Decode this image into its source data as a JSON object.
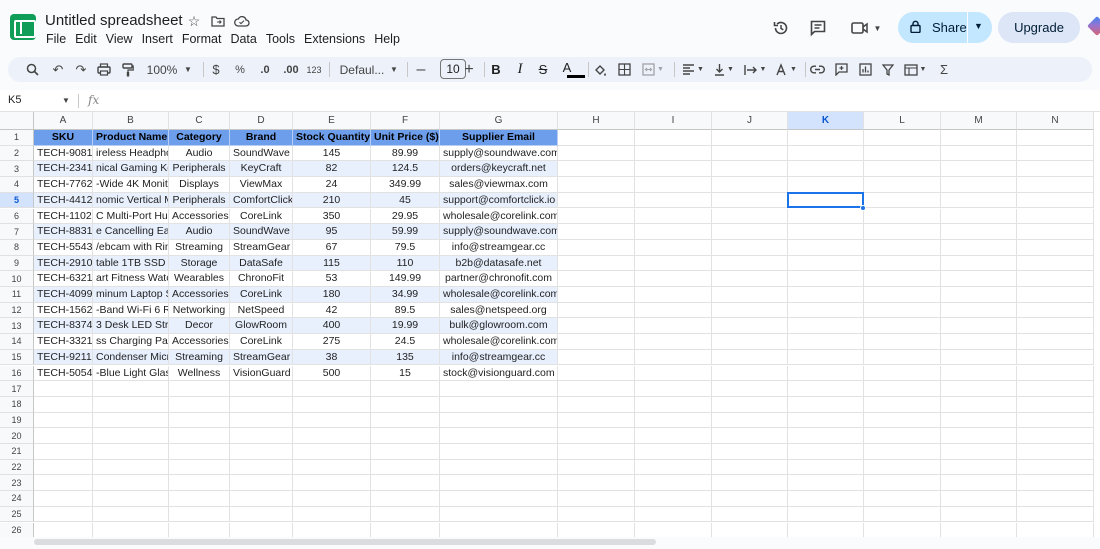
{
  "app": {
    "doc_title": "Untitled spreadsheet",
    "menu": [
      "File",
      "Edit",
      "View",
      "Insert",
      "Format",
      "Data",
      "Tools",
      "Extensions",
      "Help"
    ],
    "share_label": "Share",
    "upgrade_label": "Upgrade"
  },
  "toolbar": {
    "zoom": "100%",
    "currency": "$",
    "percent": "%",
    "dec_decrease": ".0",
    "dec_increase": ".00",
    "number_format": "123",
    "font": "Defaul...",
    "font_size": "10",
    "bold": "B",
    "italic": "I",
    "strike": "S",
    "text_color": "A"
  },
  "formula_bar": {
    "namebox": "K5",
    "fx": "fx",
    "content": ""
  },
  "grid": {
    "columns": [
      "A",
      "B",
      "C",
      "D",
      "E",
      "F",
      "G",
      "H",
      "I",
      "J",
      "K",
      "L",
      "M",
      "N"
    ],
    "selected_column": "K",
    "selected_row": 5,
    "row_count": 26,
    "header_row": [
      "SKU",
      "Product Name",
      "Category",
      "Brand",
      "Stock Quantity",
      "Unit Price ($)",
      "Supplier Email"
    ],
    "rows": [
      [
        "TECH-9081",
        "ireless Headphor",
        "Audio",
        "SoundWave",
        "145",
        "89.99",
        "supply@soundwave.com"
      ],
      [
        "TECH-2341",
        "nical Gaming Ke",
        "Peripherals",
        "KeyCraft",
        "82",
        "124.5",
        "orders@keycraft.net"
      ],
      [
        "TECH-7762",
        "-Wide 4K Monito",
        "Displays",
        "ViewMax",
        "24",
        "349.99",
        "sales@viewmax.com"
      ],
      [
        "TECH-4412",
        "nomic Vertical M",
        "Peripherals",
        "ComfortClick",
        "210",
        "45",
        "support@comfortclick.io"
      ],
      [
        "TECH-1102",
        "C Multi-Port Hub",
        "Accessories",
        "CoreLink",
        "350",
        "29.95",
        "wholesale@corelink.com"
      ],
      [
        "TECH-8831",
        "e Cancelling Earl",
        "Audio",
        "SoundWave",
        "95",
        "59.99",
        "supply@soundwave.com"
      ],
      [
        "TECH-5543",
        "/ebcam with Ring",
        "Streaming",
        "StreamGear",
        "67",
        "79.5",
        "info@streamgear.cc"
      ],
      [
        "TECH-2910",
        "table 1TB SSD D",
        "Storage",
        "DataSafe",
        "115",
        "110",
        "b2b@datasafe.net"
      ],
      [
        "TECH-6321",
        "art Fitness Watch",
        "Wearables",
        "ChronoFit",
        "53",
        "149.99",
        "partner@chronofit.com"
      ],
      [
        "TECH-4099",
        "minum Laptop St",
        "Accessories",
        "CoreLink",
        "180",
        "34.99",
        "wholesale@corelink.com"
      ],
      [
        "TECH-1562",
        "-Band Wi-Fi 6 Ro",
        "Networking",
        "NetSpeed",
        "42",
        "89.5",
        "sales@netspeed.org"
      ],
      [
        "TECH-8374",
        "3 Desk LED Strip",
        "Decor",
        "GlowRoom",
        "400",
        "19.99",
        "bulk@glowroom.com"
      ],
      [
        "TECH-3321",
        "ss Charging Pac",
        "Accessories",
        "CoreLink",
        "275",
        "24.5",
        "wholesale@corelink.com"
      ],
      [
        "TECH-9211",
        "Condenser Micro",
        "Streaming",
        "StreamGear",
        "38",
        "135",
        "info@streamgear.cc"
      ],
      [
        "TECH-5054",
        "-Blue Light Glas",
        "Wellness",
        "VisionGuard",
        "500",
        "15",
        "stock@visionguard.com"
      ]
    ]
  },
  "colors": {
    "header_fill": "#6d9eeb",
    "alt_fill": "#e8f0fe",
    "selection": "#1a73e8",
    "share_bg": "#c2e7ff"
  }
}
